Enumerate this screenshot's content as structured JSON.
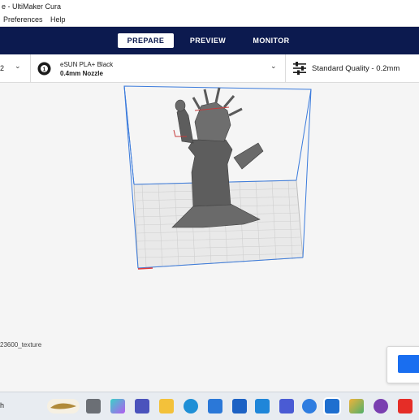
{
  "window": {
    "title": "e - UltiMaker Cura"
  },
  "menu": {
    "items": [
      "Preferences",
      "Help"
    ]
  },
  "stages": {
    "tabs": [
      "PREPARE",
      "PREVIEW",
      "MONITOR"
    ],
    "active": "PREPARE"
  },
  "printer": {
    "partial_name": "2"
  },
  "material": {
    "name": "eSUN PLA+ Black",
    "nozzle": "0.4mm Nozzle"
  },
  "quality": {
    "label": "Standard Quality - 0.2mm"
  },
  "object": {
    "name": "23600_texture"
  },
  "search": {
    "partial_text": "h"
  },
  "colors": {
    "header": "#0c1a4f",
    "accent": "#196ef0",
    "build_volume": "#3b7bdc",
    "model": "#555555"
  }
}
